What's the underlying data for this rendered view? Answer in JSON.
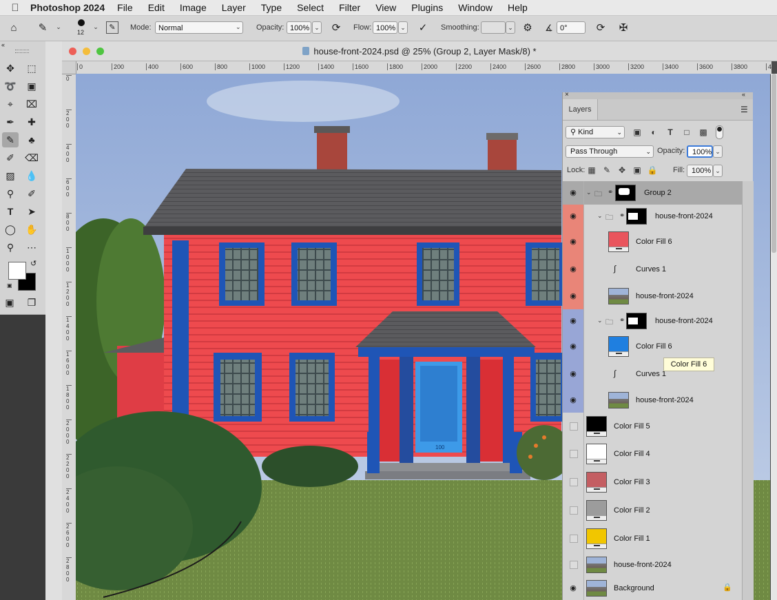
{
  "menubar": {
    "app_name": "Photoshop 2024",
    "items": [
      "File",
      "Edit",
      "Image",
      "Layer",
      "Type",
      "Select",
      "Filter",
      "View",
      "Plugins",
      "Window",
      "Help"
    ]
  },
  "options": {
    "brush_size": "12",
    "mode_label": "Mode:",
    "mode_value": "Normal",
    "opacity_label": "Opacity:",
    "opacity_value": "100%",
    "flow_label": "Flow:",
    "flow_value": "100%",
    "smoothing_label": "Smoothing:",
    "angle_value": "0°"
  },
  "document": {
    "title": "house-front-2024.psd @ 25% (Group 2, Layer Mask/8) *",
    "ruler_top": [
      "0",
      "200",
      "400",
      "600",
      "800",
      "1000",
      "1200",
      "1400",
      "1600",
      "1800",
      "2000",
      "2200",
      "2400",
      "2600",
      "2800",
      "3000",
      "3200",
      "3400",
      "3600",
      "3800",
      "4"
    ],
    "ruler_left": [
      "0",
      "2 0 0",
      "4 0 0",
      "6 0 0",
      "8 0 0",
      "1 0 0 0",
      "1 2 0 0",
      "1 4 0 0",
      "1 6 0 0",
      "1 8 0 0",
      "2 0 0 0",
      "2 2 0 0",
      "2 4 0 0",
      "2 6 0 0",
      "2 8 0 0"
    ],
    "door_number": "100"
  },
  "layers_panel": {
    "tab_label": "Layers",
    "filter_kind": "Kind",
    "blend_mode": "Pass Through",
    "opacity_label": "Opacity:",
    "opacity_value": "100%",
    "lock_label": "Lock:",
    "fill_label": "Fill:",
    "fill_value": "100%",
    "layers": [
      {
        "name": "Group 2"
      },
      {
        "name": "house-front-2024"
      },
      {
        "name": "Color Fill 6"
      },
      {
        "name": "Curves 1"
      },
      {
        "name": "house-front-2024"
      },
      {
        "name": "house-front-2024"
      },
      {
        "name": "Color Fill 6"
      },
      {
        "name": "Curves 1"
      },
      {
        "name": "house-front-2024"
      },
      {
        "name": "Color Fill 5"
      },
      {
        "name": "Color Fill 4"
      },
      {
        "name": "Color Fill 3"
      },
      {
        "name": "Color Fill 2"
      },
      {
        "name": "Color Fill 1"
      },
      {
        "name": "house-front-2024"
      },
      {
        "name": "Background"
      }
    ]
  },
  "tooltip": {
    "text": "Color Fill 6"
  },
  "colors": {
    "red_fill": "#e9555d",
    "blue_fill": "#1f7fe0",
    "black_fill": "#000000",
    "white_fill": "#ffffff",
    "rose_fill": "#c45e62",
    "gray_fill": "#9c9c9c",
    "yellow_fill": "#f1c600",
    "row_red": "#e98578",
    "row_blue": "#98a6d6"
  }
}
